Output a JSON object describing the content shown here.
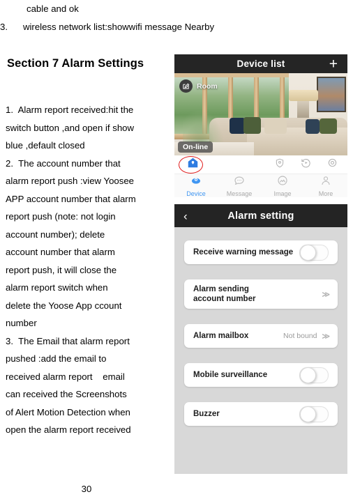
{
  "document": {
    "top_lines": [
      {
        "text": "cable and ok",
        "numbered": false
      },
      {
        "text": "3.      wireless network list:showwifi message Nearby",
        "numbered": true
      }
    ],
    "section_heading": "Section 7 Alarm Settings",
    "body_lines": [
      "1.  Alarm report received:hit the",
      "switch button ,and open if show",
      "blue ,default closed",
      "2.  The account number that",
      "alarm report push :view Yoosee",
      "APP account number that alarm",
      "report push (note: not login",
      "account number); delete",
      "account number that alarm",
      "report push, it will close the",
      "alarm report switch when",
      "delete the Yoose App ccount",
      "number",
      "3.  The Email that alarm report",
      "pushed :add the email to",
      "received alarm report    email",
      "can received the Screenshots",
      "of Alert Motion Detection when",
      "open the alarm report received"
    ],
    "page_number": "30"
  },
  "device_list_screen": {
    "nav": {
      "title": "Device list",
      "add_label": "+"
    },
    "camera_card": {
      "room_label": "Room",
      "status_label": "On-line",
      "edit_icon": "edit-pencil-icon"
    },
    "quick_icons": {
      "highlighted": "alarm-home-shield-icon",
      "others": [
        "shield-icon",
        "playback-icon",
        "settings-gear-icon"
      ]
    },
    "tabs": [
      {
        "label": "Device",
        "icon": "device-icon",
        "active": true
      },
      {
        "label": "Message",
        "icon": "message-bubble-icon",
        "active": false
      },
      {
        "label": "Image",
        "icon": "image-icon",
        "active": false
      },
      {
        "label": "More",
        "icon": "person-icon",
        "active": false
      }
    ]
  },
  "alarm_setting_screen": {
    "nav": {
      "back_label": "‹",
      "title": "Alarm setting"
    },
    "rows": [
      {
        "label": "Receive warning message",
        "control": "toggle",
        "value": "",
        "state": "off"
      },
      {
        "label": "Alarm sending\naccount number",
        "control": "chevron",
        "value": "",
        "chevron": "≫"
      },
      {
        "label": "Alarm mailbox",
        "control": "chevron",
        "value": "Not bound",
        "chevron": "≫"
      },
      {
        "label": "Mobile surveillance",
        "control": "toggle",
        "value": "",
        "state": "off"
      },
      {
        "label": "Buzzer",
        "control": "toggle",
        "value": "",
        "state": "off"
      }
    ]
  },
  "colors": {
    "nav_bar": "#242424",
    "page_bg": "#d8d8d8",
    "accent_blue": "#3f96f2",
    "highlight_red": "#e01b1b",
    "muted_text": "#9a9a9a"
  }
}
